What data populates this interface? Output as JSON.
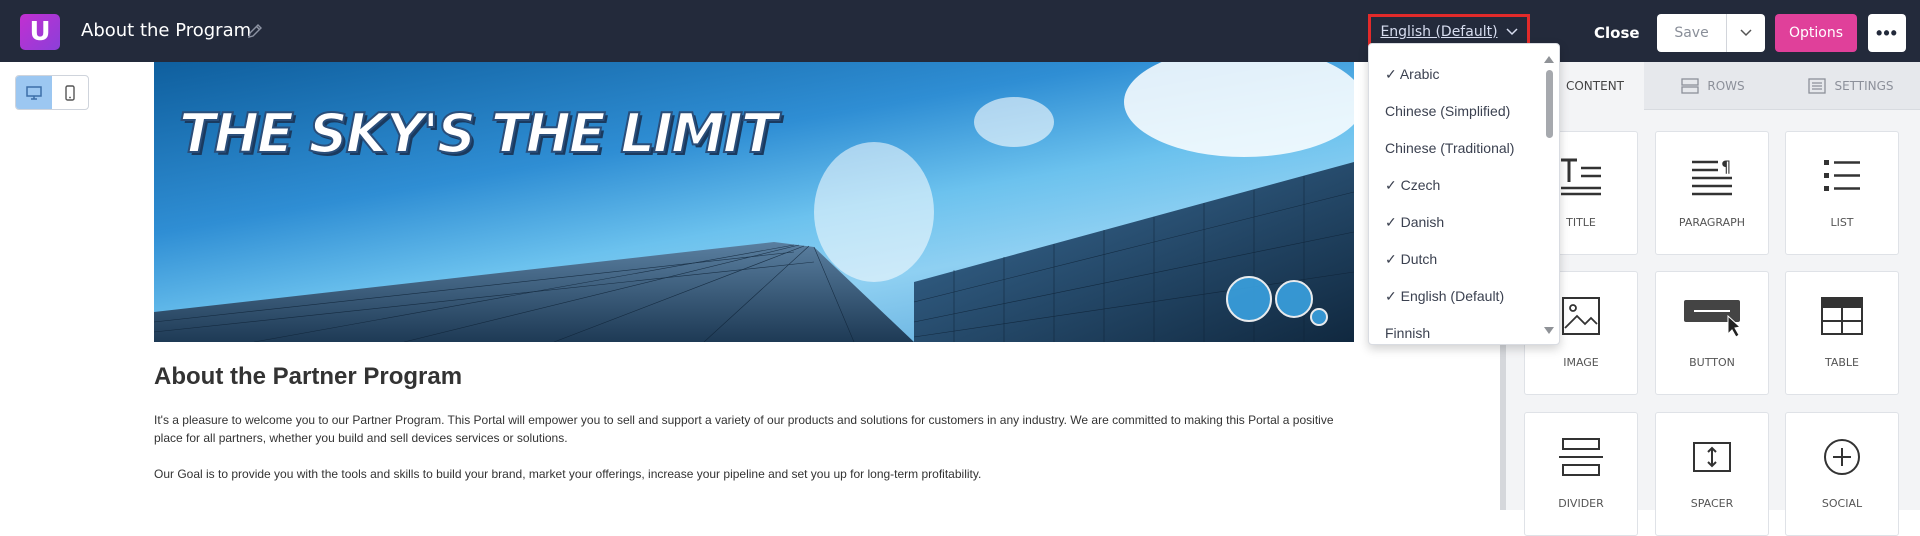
{
  "header": {
    "logo_letter": "U",
    "page_title": "About the Program",
    "language_selected": "English (Default)",
    "close_label": "Close",
    "save_label": "Save",
    "options_label": "Options",
    "more_label": "•••"
  },
  "hero": {
    "title": "THE SKY'S THE LIMIT"
  },
  "content": {
    "heading": "About the Partner Program",
    "paragraph1": " It's a pleasure to welcome you to our Partner Program. This Portal will empower you to sell and support a variety of our products and solutions for customers in any industry. We are committed to making this Portal a positive place for all partners, whether you build and sell devices services or solutions.",
    "paragraph2": "Our Goal is to provide you with the tools and skills to build your brand, market your offerings, increase your pipeline and set you up for long-term profitability."
  },
  "language_dropdown": {
    "items": [
      "✓ Arabic",
      "Chinese (Simplified)",
      "Chinese (Traditional)",
      "✓ Czech",
      "✓ Danish",
      "✓ Dutch",
      "✓ English (Default)",
      "Finnish"
    ]
  },
  "sidebar": {
    "tabs": [
      "CONTENT",
      "ROWS",
      "SETTINGS"
    ],
    "tiles": [
      "TITLE",
      "PARAGRAPH",
      "LIST",
      "IMAGE",
      "BUTTON",
      "TABLE",
      "DIVIDER",
      "SPACER",
      "SOCIAL"
    ]
  },
  "colors": {
    "topbar": "#232a3b",
    "accent_pink": "#e0409a",
    "highlight_red": "#e22a2a"
  }
}
